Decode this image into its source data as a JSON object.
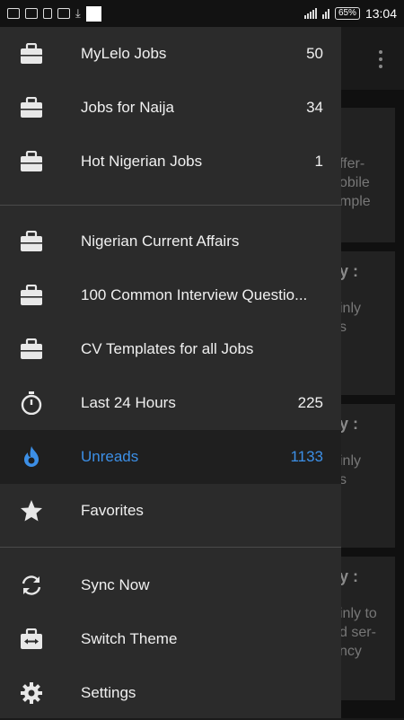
{
  "status_bar": {
    "battery": "65%",
    "time": "13:04"
  },
  "background": {
    "cards": [
      {
        "title": "",
        "lines": [
          "ffer-",
          "obile",
          "mple"
        ]
      },
      {
        "title": "y :",
        "lines": [
          "inly",
          "s"
        ]
      },
      {
        "title": "y :",
        "lines": [
          "inly",
          "s"
        ]
      },
      {
        "title": "y :",
        "lines": [
          "inly to",
          "d ser-",
          "ncy"
        ]
      }
    ]
  },
  "drawer": {
    "feeds": [
      {
        "label": "MyLelo Jobs",
        "count": "50",
        "icon": "briefcase-icon"
      },
      {
        "label": "Jobs for Naija",
        "count": "34",
        "icon": "briefcase-icon"
      },
      {
        "label": "Hot Nigerian Jobs",
        "count": "1",
        "icon": "briefcase-icon"
      }
    ],
    "categories": [
      {
        "label": "Nigerian Current Affairs",
        "count": "",
        "icon": "briefcase-icon"
      },
      {
        "label": "100 Common Interview Questio...",
        "count": "",
        "icon": "briefcase-icon"
      },
      {
        "label": "CV Templates for all Jobs",
        "count": "",
        "icon": "briefcase-icon"
      },
      {
        "label": "Last 24 Hours",
        "count": "225",
        "icon": "stopwatch-icon"
      },
      {
        "label": "Unreads",
        "count": "1133",
        "icon": "flame-icon"
      },
      {
        "label": "Favorites",
        "count": "",
        "icon": "star-icon"
      }
    ],
    "actions": [
      {
        "label": "Sync Now",
        "icon": "sync-icon"
      },
      {
        "label": "Switch Theme",
        "icon": "switch-theme-icon"
      },
      {
        "label": "Settings",
        "icon": "gear-icon"
      }
    ],
    "accent_color": "#3c8fe6"
  }
}
